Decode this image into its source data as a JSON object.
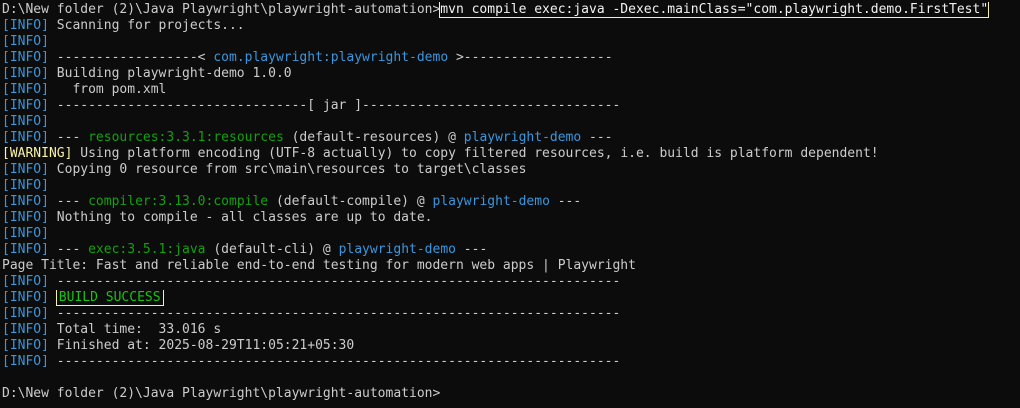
{
  "prompt": "D:\\New folder (2)\\Java Playwright\\playwright-automation>",
  "command": "mvn compile exec:java -Dexec.mainClass=\"com.playwright.demo.FirstTest\"",
  "tags": {
    "info": "[INFO]",
    "warning": "[WARNING]"
  },
  "lines": {
    "l1": " Scanning for projects...",
    "l2": "",
    "l3_pre": " ------------------< ",
    "l3_artifact": "com.playwright:playwright-demo",
    "l3_post": " >-------------------",
    "l4": " Building playwright-demo 1.0.0",
    "l5": "   from pom.xml",
    "l6": " --------------------------------[ jar ]---------------------------------",
    "l7": "",
    "l8_pre": " --- ",
    "l8_plugin": "resources:3.3.1:resources",
    "l8_mid": " (default-resources) @ ",
    "l8_proj": "playwright-demo",
    "l8_post": " ---",
    "l9": " Using platform encoding (UTF-8 actually) to copy filtered resources, i.e. build is platform dependent!",
    "l10": " Copying 0 resource from src\\main\\resources to target\\classes",
    "l11": "",
    "l12_pre": " --- ",
    "l12_plugin": "compiler:3.13.0:compile",
    "l12_mid": " (default-compile) @ ",
    "l12_proj": "playwright-demo",
    "l12_post": " ---",
    "l13": " Nothing to compile - all classes are up to date.",
    "l14": "",
    "l15_pre": " --- ",
    "l15_plugin": "exec:3.5.1:java",
    "l15_mid": " (default-cli) @ ",
    "l15_proj": "playwright-demo",
    "l15_post": " ---",
    "l16": "Page Title: Fast and reliable end-to-end testing for modern web apps | Playwright",
    "l17": " ------------------------------------------------------------------------",
    "l18": "BUILD SUCCESS",
    "l19": " ------------------------------------------------------------------------",
    "l20": " Total time:  33.016 s",
    "l21": " Finished at: 2025-08-29T11:05:21+05:30",
    "l22": " ------------------------------------------------------------------------"
  },
  "final_prompt": "D:\\New folder (2)\\Java Playwright\\playwright-automation>",
  "colors": {
    "background": "#0c0c0c",
    "text": "#cccccc",
    "info_tag": "#3a96dd",
    "warning_tag": "#f9f1a5",
    "plugin": "#13a10e",
    "project": "#3a96dd",
    "success": "#16c60c",
    "highlight_box": "#f9f1a5"
  }
}
